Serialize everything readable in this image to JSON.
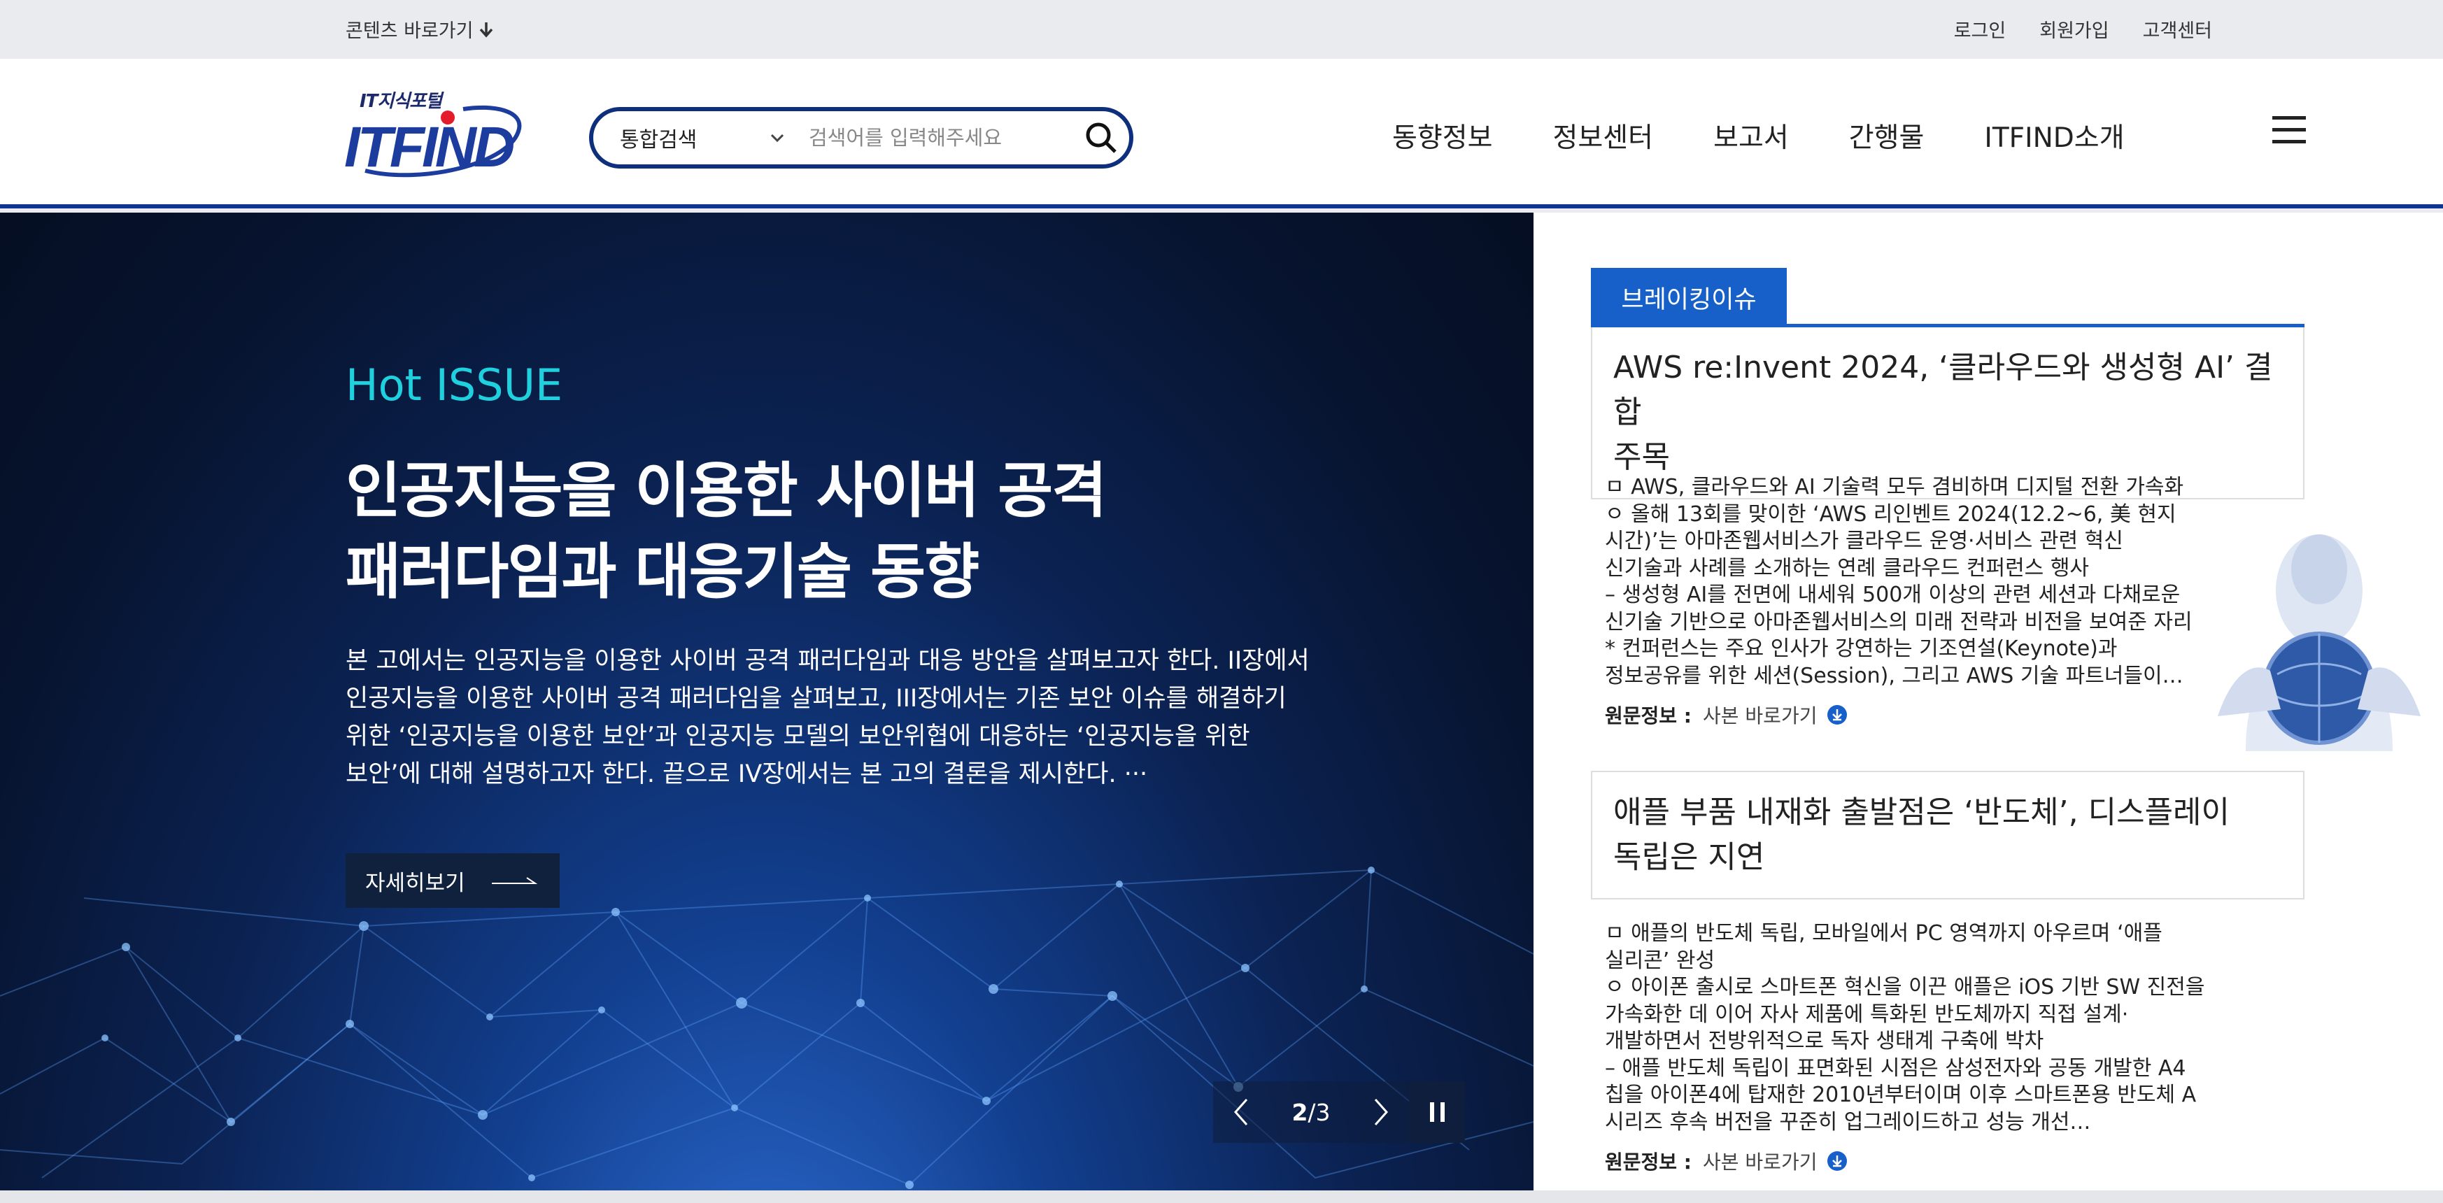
{
  "topbar": {
    "skip_link": "콘텐츠 바로가기",
    "util_links": [
      "로그인",
      "회원가입",
      "고객센터"
    ]
  },
  "header": {
    "logo_tagline": "IT지식포털",
    "logo_text": "ITFIND",
    "search": {
      "type_selected": "통합검색",
      "placeholder": "검색어를 입력해주세요"
    },
    "nav": [
      "동향정보",
      "정보센터",
      "보고서",
      "간행물",
      "ITFIND소개"
    ]
  },
  "hero": {
    "label": "Hot ISSUE",
    "title_line1": "인공지능을 이용한 사이버 공격",
    "title_line2": "패러다임과 대응기술 동향",
    "desc_lines": [
      "본 고에서는 인공지능을 이용한 사이버 공격 패러다임과 대응 방안을 살펴보고자 한다. II장에서",
      "인공지능을 이용한 사이버 공격 패러다임을 살펴보고, III장에서는 기존 보안 이슈를 해결하기",
      "위한 ‘인공지능을 이용한 보안’과 인공지능 모델의 보안위협에 대응하는 ‘인공지능을 위한",
      "보안’에 대해 설명하고자 한다. 끝으로 IV장에서는 본 고의 결론을 제시한다. ···"
    ],
    "more_button": "자세히보기",
    "pager": {
      "current": "2",
      "separator": "/",
      "total": "3"
    }
  },
  "breaking": {
    "tab_label": "브레이킹이슈",
    "source_label": "원문정보 :",
    "source_link": "사본 바로가기",
    "items": [
      {
        "title_line1": "AWS re:Invent 2024, ‘클라우드와 생성형 AI’ 결합",
        "title_line2": "주목",
        "body": [
          "ㅁ AWS, 클라우드와 AI 기술력 모두 겸비하며 디지털 전환 가속화",
          "ㅇ 올해 13회를 맞이한 ‘AWS 리인벤트 2024(12.2~6, 美 현지",
          "시간)’는 아마존웹서비스가 클라우드 운영·서비스 관련 혁신",
          "신기술과 사례를 소개하는 연례 클라우드 컨퍼런스 행사",
          "– 생성형 AI를 전면에 내세워 500개 이상의 관련 세션과 다채로운",
          "신기술 기반으로 아마존웹서비스의 미래 전략과 비전을 보여준 자리",
          "* 컨퍼런스는 주요 인사가 강연하는 기조연설(Keynote)과",
          "정보공유를 위한 세션(Session), 그리고 AWS 기술 파트너들이…"
        ]
      },
      {
        "title_line1": "애플 부품 내재화 출발점은 ‘반도체’, 디스플레이",
        "title_line2": "독립은 지연",
        "body": [
          "ㅁ 애플의 반도체 독립, 모바일에서 PC 영역까지 아우르며 ‘애플",
          "실리콘’ 완성",
          "ㅇ 아이폰 출시로 스마트폰 혁신을 이끈 애플은 iOS 기반 SW 진전을",
          "가속화한 데 이어 자사 제품에 특화된 반도체까지 직접 설계·",
          "개발하면서 전방위적으로 독자 생태계 구축에 박차",
          "– 애플 반도체 독립이 표면화된 시점은 삼성전자와 공동 개발한 A4",
          "칩을 아이폰4에 탑재한 2010년부터이며 이후 스마트폰용 반도체 A",
          "시리즈 후속 버전을 꾸준히 업그레이드하고 성능 개선…"
        ]
      }
    ]
  },
  "colors": {
    "brand_navy": "#0d2f7c",
    "hero_label": "#1fd1de",
    "breaking_blue": "#1760c9"
  }
}
